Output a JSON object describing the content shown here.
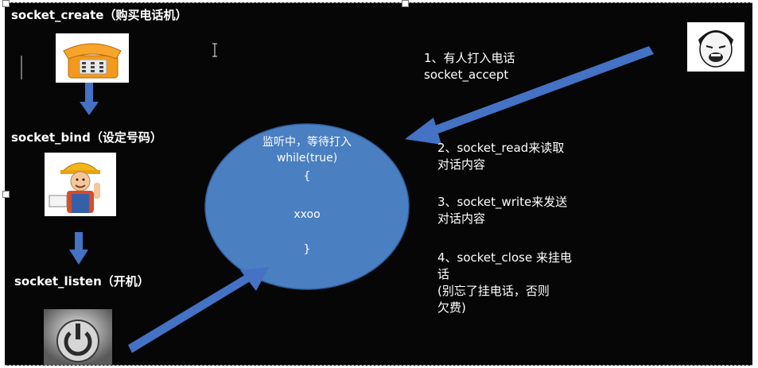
{
  "left_column": {
    "create_label": "socket_create（购买电话机）",
    "bind_label": "socket_bind（设定号码）",
    "listen_label": "socket_listen（开机）"
  },
  "circle": {
    "line1": "监听中，等待打入",
    "line2": "while(true)",
    "line3": "{",
    "line4": "xxoo",
    "line5": "}"
  },
  "steps": {
    "step1_line1": "1、有人打入电话",
    "step1_line2": "socket_accept",
    "step2_line1": "2、socket_read来读取",
    "step2_line2": "对话内容",
    "step3_line1": "3、socket_write来发送",
    "step3_line2": "对话内容",
    "step4_line1": "4、socket_close 来挂电",
    "step4_line2": "话",
    "step4_line3": "(别忘了挂电话，否则",
    "step4_line4": "欠费)"
  },
  "colors": {
    "background": "#060606",
    "circle": "#4a7fc1",
    "arrow": "#4472c4",
    "phone": "#f39a1e",
    "text": "#ffffff"
  },
  "icons": [
    "telephone-icon",
    "worker-icon",
    "power-button-icon",
    "meme-face-icon",
    "text-cursor-icon"
  ]
}
